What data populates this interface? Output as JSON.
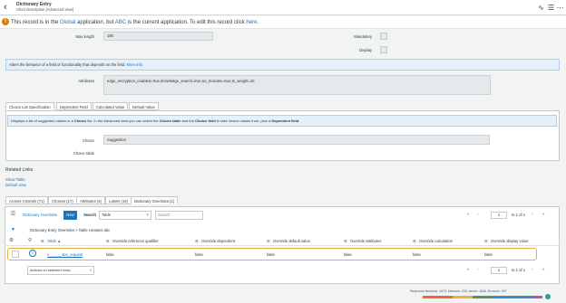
{
  "header": {
    "title": "Dictionary Entry",
    "subtitle": "Short description [Advanced view]",
    "icons": [
      "activity-icon",
      "settings-icon",
      "menu-icon"
    ]
  },
  "banner": {
    "prefix": "This record is in the ",
    "global": "Global",
    "mid1": " application, but ",
    "abc": "ABC",
    "mid2": " is the current application. To edit this record click ",
    "here": "here",
    "end": "."
  },
  "form": {
    "max_length_label": "Max length",
    "max_length_value": "180",
    "mandatory_label": "Mandatory",
    "display_label": "Display",
    "info_text": "Alters the behavior of a field or functionality that depends on the field.",
    "info_link": "More Info",
    "attributes_label": "Attributes",
    "attributes_value": "edge_encryption_enabled=true,knowledge_search=true,no_truncate=true,ts_weight=10"
  },
  "tabs": [
    "Choice List Specification",
    "Dependent Field",
    "Calculated Value",
    "Default Value"
  ],
  "choice": {
    "info_a": "Displays a list of suggested values in a ",
    "info_b": "Choice",
    "info_c": " list. In the Advanced view you can select the ",
    "info_d": "Choice table",
    "info_e": " and the ",
    "info_f": "Choice field",
    "info_g": " to take choice values from, plus a ",
    "info_h": "Dependent field",
    "info_i": ".",
    "choice_label": "Choice",
    "choice_value": "Suggestion",
    "choice_table_label": "Choice table"
  },
  "related": {
    "heading": "Related Links",
    "links": [
      "Show Table",
      "Default view"
    ]
  },
  "related_tabs": [
    "Access Controls (71)",
    "Choices (17)",
    "Attributes (4)",
    "Labels (16)",
    "Dictionary Overrides (1)"
  ],
  "list": {
    "title": "Dictionary Overrides",
    "new_label": "New",
    "search_label": "Search",
    "search_field": "Table",
    "search_placeholder": "Search",
    "page_input": "1",
    "page_of": "to 1 of 1",
    "breadcrumb": "Dictionary Entry Overrides  >  Table contains abc",
    "columns": [
      "Table",
      "Override reference qualifier",
      "Override dependent",
      "Override default value",
      "Override attributes",
      "Override calculation",
      "Override display value"
    ],
    "row": {
      "table": "x______abc_request",
      "values": [
        "false",
        "false",
        "false",
        "false",
        "false",
        "false"
      ]
    },
    "actions_placeholder": "Actions on selected rows...",
    "bottom_page_input": "1",
    "bottom_page_of": "to 1 of 1"
  },
  "footer": {
    "text": "Response time(ms): 4473, Network: 230, server: 1646,",
    "link": "Browser: 597"
  },
  "colors": {
    "accent": "#1f73b7",
    "warning": "#e07b00",
    "highlight": "#e2b13c",
    "bar": [
      "#e86a3a",
      "#e8b33a",
      "#4e9a5c",
      "#3a8fd1",
      "#b04fd1"
    ]
  }
}
